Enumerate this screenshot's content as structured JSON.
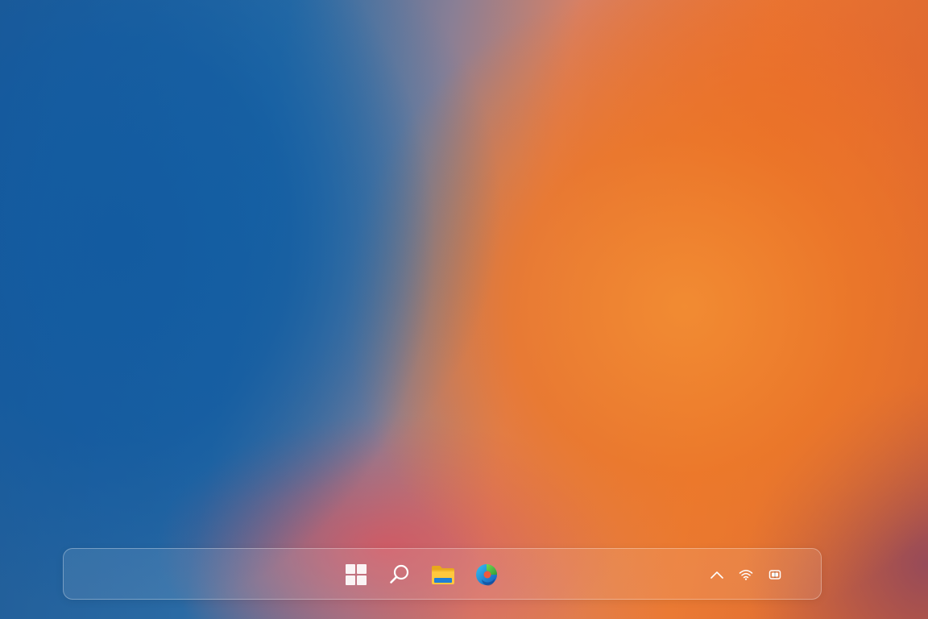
{
  "desktop": {
    "wallpaper": "blue-orange-gradient",
    "colors": {
      "blue": "#1e5a96",
      "orange": "#ea7a35",
      "pink": "#d7555f"
    }
  },
  "taskbar": {
    "pinned": [
      {
        "name": "start",
        "icon": "windows-logo-icon"
      },
      {
        "name": "search",
        "icon": "search-icon"
      },
      {
        "name": "file-explorer",
        "icon": "folder-icon"
      },
      {
        "name": "edge",
        "icon": "edge-icon"
      }
    ],
    "tray": [
      {
        "name": "show-hidden-icons",
        "icon": "chevron-up-icon"
      },
      {
        "name": "network",
        "icon": "wifi-icon"
      },
      {
        "name": "battery",
        "icon": "battery-icon"
      }
    ]
  }
}
